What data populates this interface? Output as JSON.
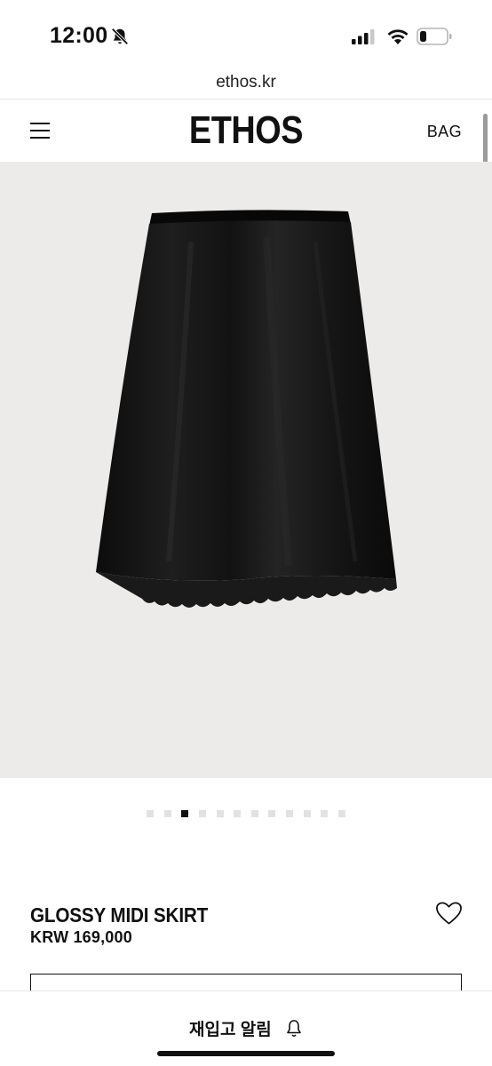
{
  "status_bar": {
    "time": "12:00",
    "icons": [
      "bell-slash-icon",
      "cellular-signal-icon",
      "wifi-icon",
      "battery-icon"
    ]
  },
  "browser": {
    "url": "ethos.kr"
  },
  "header": {
    "menu_icon": "hamburger-menu-icon",
    "logo": "ETHOS",
    "bag": "BAG"
  },
  "product": {
    "image_description_icon": "black-midi-skirt-photo",
    "gallery": {
      "total": 12,
      "active_index": 2
    },
    "name": "GLOSSY MIDI SKIRT",
    "price": "KRW 169,000",
    "wishlist_icon": "heart-icon"
  },
  "bottom_bar": {
    "restock_label": "재입고 알림",
    "restock_icon": "bell-icon"
  },
  "colors": {
    "image_background": "#ecebea",
    "text": "#111111",
    "dot_inactive": "#e2e2e2"
  }
}
